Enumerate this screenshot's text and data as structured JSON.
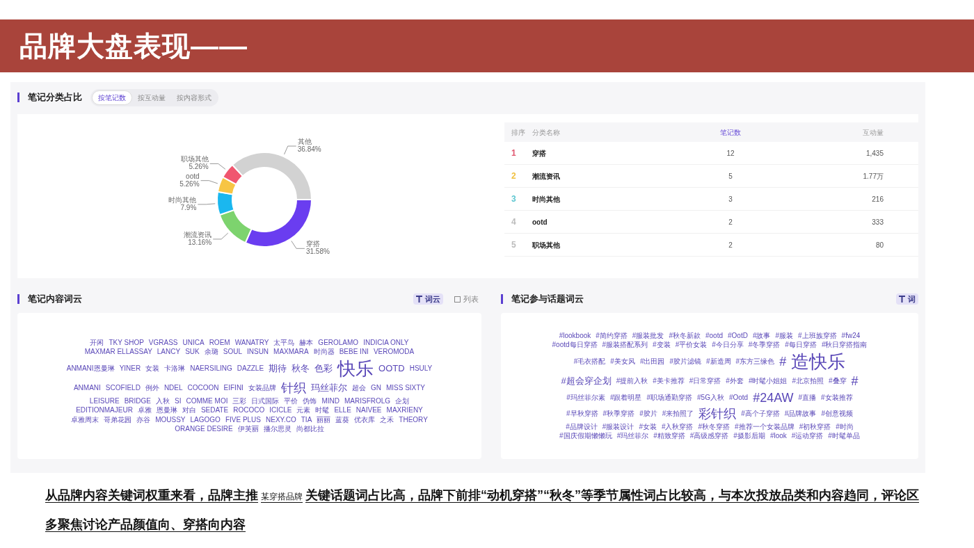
{
  "slide_title": "品牌大盘表现——",
  "category_section": {
    "title": "笔记分类占比",
    "tabs": [
      {
        "label": "按笔记数",
        "selected": true
      },
      {
        "label": "按互动量",
        "selected": false
      },
      {
        "label": "按内容形式",
        "selected": false
      }
    ],
    "chart_data": {
      "type": "donut",
      "categories": [
        "穿搭",
        "潮流资讯",
        "时尚其他",
        "ootd",
        "职场其他",
        "其他"
      ],
      "values": [
        31.58,
        13.16,
        7.9,
        5.26,
        5.26,
        36.84
      ],
      "colors": [
        "#6a3df0",
        "#7dd36e",
        "#1ab7ef",
        "#f7c544",
        "#f0566f",
        "#d2d2d2"
      ],
      "value_labels": [
        "31.58%",
        "13.16%",
        "7.9%",
        "5.26%",
        "5.26%",
        "36.84%"
      ]
    },
    "table": {
      "columns": [
        {
          "label": "排序",
          "selected": false
        },
        {
          "label": "分类名称",
          "selected": false
        },
        {
          "label": "笔记数",
          "selected": true
        },
        {
          "label": "互动量",
          "selected": false
        }
      ],
      "rows": [
        {
          "rank": "1",
          "color": "#e0566e",
          "name": "穿搭",
          "notes": "12",
          "interactions": "1,435"
        },
        {
          "rank": "2",
          "color": "#f0c040",
          "name": "潮流资讯",
          "notes": "5",
          "interactions": "1.77万"
        },
        {
          "rank": "3",
          "color": "#5cc6d0",
          "name": "时尚其他",
          "notes": "3",
          "interactions": "216"
        },
        {
          "rank": "4",
          "color": "#bbbbbb",
          "name": "ootd",
          "notes": "2",
          "interactions": "333"
        },
        {
          "rank": "5",
          "color": "#bbbbbb",
          "name": "职场其他",
          "notes": "2",
          "interactions": "80"
        }
      ]
    }
  },
  "content_cloud": {
    "title": "笔记内容词云",
    "toggles": [
      {
        "label": "词云",
        "kind": "cloud",
        "selected": true
      },
      {
        "label": "列表",
        "kind": "list",
        "selected": false
      }
    ],
    "words": [
      {
        "text": "开闲",
        "kind": "s"
      },
      {
        "text": "TKY SHOP",
        "kind": "s"
      },
      {
        "text": "VGRASS",
        "kind": "s"
      },
      {
        "text": "UNICA",
        "kind": "s"
      },
      {
        "text": "ROEM",
        "kind": "s"
      },
      {
        "text": "WANATRY",
        "kind": "s"
      },
      {
        "text": "太平鸟",
        "kind": "s"
      },
      {
        "text": "赫本",
        "kind": "s"
      },
      {
        "text": "GEROLAMO",
        "kind": "s"
      },
      {
        "text": "INDICIA ONLY",
        "kind": "s"
      },
      {
        "text": "MAXMAR ELLASSAY",
        "kind": "s"
      },
      {
        "text": "LANCY",
        "kind": "s"
      },
      {
        "text": "SUK",
        "kind": "s"
      },
      {
        "text": "余璐",
        "kind": "s"
      },
      {
        "text": "SOUL",
        "kind": "s"
      },
      {
        "text": "INSUN",
        "kind": "s"
      },
      {
        "text": "MAXMARA",
        "kind": "s"
      },
      {
        "text": "时尚器",
        "kind": "s"
      },
      {
        "text": "BEBE INI",
        "kind": "s"
      },
      {
        "text": "VEROMODA",
        "kind": "s"
      },
      {
        "text": "ANMANI恩曼琳",
        "kind": "s"
      },
      {
        "text": "YINER",
        "kind": "s"
      },
      {
        "text": "女装",
        "kind": "s"
      },
      {
        "text": "卡洛琳",
        "kind": "s"
      },
      {
        "text": "NAERSILING",
        "kind": "s"
      },
      {
        "text": "DAZZLE",
        "kind": "s"
      },
      {
        "text": "期待",
        "kind": "m"
      },
      {
        "text": "秋冬",
        "kind": "m"
      },
      {
        "text": "色彩",
        "kind": "m"
      },
      {
        "text": "快乐",
        "kind": "xl"
      },
      {
        "text": "OOTD",
        "kind": "m"
      },
      {
        "text": "HSULY",
        "kind": "s"
      },
      {
        "text": "ANMANI",
        "kind": "s"
      },
      {
        "text": "SCOFIELD",
        "kind": "s"
      },
      {
        "text": "例外",
        "kind": "s"
      },
      {
        "text": "NDEL",
        "kind": "s"
      },
      {
        "text": "COCOON",
        "kind": "s"
      },
      {
        "text": "EIFINI",
        "kind": "s"
      },
      {
        "text": "女装品牌",
        "kind": "s"
      },
      {
        "text": "针织",
        "kind": "l"
      },
      {
        "text": "玛丝菲尔",
        "kind": "m"
      },
      {
        "text": "超会",
        "kind": "s"
      },
      {
        "text": "GN",
        "kind": "s"
      },
      {
        "text": "MISS SIXTY",
        "kind": "s"
      },
      {
        "text": "LEISURE",
        "kind": "s"
      },
      {
        "text": "BRIDGE",
        "kind": "s"
      },
      {
        "text": "入秋",
        "kind": "s"
      },
      {
        "text": "SI",
        "kind": "s"
      },
      {
        "text": "COMME MOI",
        "kind": "s"
      },
      {
        "text": "三彩",
        "kind": "s"
      },
      {
        "text": "日式国际",
        "kind": "s"
      },
      {
        "text": "平价",
        "kind": "s"
      },
      {
        "text": "伪饰",
        "kind": "s"
      },
      {
        "text": "MIND",
        "kind": "s"
      },
      {
        "text": "MARISFROLG",
        "kind": "s"
      },
      {
        "text": "企划",
        "kind": "s"
      },
      {
        "text": "EDITIONMAJEUR",
        "kind": "s"
      },
      {
        "text": "卓雅",
        "kind": "s"
      },
      {
        "text": "恩曼琳",
        "kind": "s"
      },
      {
        "text": "对白",
        "kind": "s"
      },
      {
        "text": "SEDATE",
        "kind": "s"
      },
      {
        "text": "ROCOCO",
        "kind": "s"
      },
      {
        "text": "ICICLE",
        "kind": "s"
      },
      {
        "text": "元素",
        "kind": "s"
      },
      {
        "text": "时髦",
        "kind": "s"
      },
      {
        "text": "ELLE",
        "kind": "s"
      },
      {
        "text": "NAIVEE",
        "kind": "s"
      },
      {
        "text": "MAXRIENY",
        "kind": "s"
      },
      {
        "text": "卓雅周末",
        "kind": "s"
      },
      {
        "text": "哥弟花园",
        "kind": "s"
      },
      {
        "text": "亦谷",
        "kind": "s"
      },
      {
        "text": "MOUSSY",
        "kind": "s"
      },
      {
        "text": "LAGOGO",
        "kind": "s"
      },
      {
        "text": "FIVE PLUS",
        "kind": "s"
      },
      {
        "text": "NEXY.CO",
        "kind": "s"
      },
      {
        "text": "TIA",
        "kind": "s"
      },
      {
        "text": "丽丽",
        "kind": "s"
      },
      {
        "text": "蓝葵",
        "kind": "s"
      },
      {
        "text": "优衣库",
        "kind": "s"
      },
      {
        "text": "之禾",
        "kind": "s"
      },
      {
        "text": "THEORY",
        "kind": "s"
      },
      {
        "text": "ORANGE DESIRE",
        "kind": "s"
      },
      {
        "text": "伊芙丽",
        "kind": "s"
      },
      {
        "text": "播尔思灵",
        "kind": "s"
      },
      {
        "text": "尚都比拉",
        "kind": "s"
      }
    ]
  },
  "topic_cloud": {
    "title": "笔记参与话题词云",
    "toggles": [
      {
        "label": "词",
        "kind": "cloud",
        "selected": true
      }
    ],
    "words": [
      {
        "text": "#lookbook",
        "kind": "s"
      },
      {
        "text": "#简约穿搭",
        "kind": "s"
      },
      {
        "text": "#服装批发",
        "kind": "s"
      },
      {
        "text": "#秋冬新款",
        "kind": "s"
      },
      {
        "text": "#ootd",
        "kind": "s"
      },
      {
        "text": "#OotD",
        "kind": "s"
      },
      {
        "text": "#故事",
        "kind": "s"
      },
      {
        "text": "#服装",
        "kind": "s"
      },
      {
        "text": "#上班族穿搭",
        "kind": "s"
      },
      {
        "text": "#fw24",
        "kind": "s"
      },
      {
        "text": "#ootd每日穿搭",
        "kind": "s"
      },
      {
        "text": "#服装搭配系列",
        "kind": "s"
      },
      {
        "text": "#变装",
        "kind": "s"
      },
      {
        "text": "#平价女装",
        "kind": "s"
      },
      {
        "text": "#今日分享",
        "kind": "s"
      },
      {
        "text": "#冬季穿搭",
        "kind": "s"
      },
      {
        "text": "#每日穿搭",
        "kind": "s"
      },
      {
        "text": "#秋日穿搭指南",
        "kind": "s"
      },
      {
        "text": "#毛衣搭配",
        "kind": "s"
      },
      {
        "text": "#美女风",
        "kind": "s"
      },
      {
        "text": "#出田园",
        "kind": "s"
      },
      {
        "text": "#胶片滤镜",
        "kind": "s"
      },
      {
        "text": "#新造周",
        "kind": "s"
      },
      {
        "text": "#东方三缘色",
        "kind": "s"
      },
      {
        "text": "#",
        "kind": "l"
      },
      {
        "text": "造快乐",
        "kind": "xl"
      },
      {
        "text": "#超会穿企划",
        "kind": "m"
      },
      {
        "text": "#提前入秋",
        "kind": "s"
      },
      {
        "text": "#美卡推荐",
        "kind": "s"
      },
      {
        "text": "#日常穿搭",
        "kind": "s"
      },
      {
        "text": "#外套",
        "kind": "s"
      },
      {
        "text": "#时髦小姐姐",
        "kind": "s"
      },
      {
        "text": "#北京拍照",
        "kind": "s"
      },
      {
        "text": "#叠穿",
        "kind": "s"
      },
      {
        "text": "#",
        "kind": "l"
      },
      {
        "text": "#玛丝菲尔素",
        "kind": "s"
      },
      {
        "text": "#跟着明星",
        "kind": "s"
      },
      {
        "text": "#职场通勤穿搭",
        "kind": "s"
      },
      {
        "text": "#5G入秋",
        "kind": "s"
      },
      {
        "text": "#Ootd",
        "kind": "s"
      },
      {
        "text": "#24AW",
        "kind": "l"
      },
      {
        "text": "#直播",
        "kind": "s"
      },
      {
        "text": "#女装推荐",
        "kind": "s"
      },
      {
        "text": "#早秋穿搭",
        "kind": "s"
      },
      {
        "text": "#秋季穿搭",
        "kind": "s"
      },
      {
        "text": "#胶片",
        "kind": "s"
      },
      {
        "text": "#来拍照了",
        "kind": "s"
      },
      {
        "text": "彩针织",
        "kind": "l"
      },
      {
        "text": "#高个子穿搭",
        "kind": "s"
      },
      {
        "text": "#品牌故事",
        "kind": "s"
      },
      {
        "text": "#创意视频",
        "kind": "s"
      },
      {
        "text": "#品牌设计",
        "kind": "s"
      },
      {
        "text": "#服装设计",
        "kind": "s"
      },
      {
        "text": "#女装",
        "kind": "s"
      },
      {
        "text": "#入秋穿搭",
        "kind": "s"
      },
      {
        "text": "#秋冬穿搭",
        "kind": "s"
      },
      {
        "text": "#推荐一个女装品牌",
        "kind": "s"
      },
      {
        "text": "#初秋穿搭",
        "kind": "s"
      },
      {
        "text": "#时尚",
        "kind": "s"
      },
      {
        "text": "#国庆假期懒懒玩",
        "kind": "s"
      },
      {
        "text": "#玛丝菲尔",
        "kind": "s"
      },
      {
        "text": "#精致穿搭",
        "kind": "s"
      },
      {
        "text": "#高级感穿搭",
        "kind": "s"
      },
      {
        "text": "#摄影后期",
        "kind": "s"
      },
      {
        "text": "#look",
        "kind": "s"
      },
      {
        "text": "#运动穿搭",
        "kind": "s"
      },
      {
        "text": "#时髦单品",
        "kind": "s"
      }
    ]
  },
  "summary": {
    "parts": [
      {
        "text": "从品牌内容关键词权重来看，品牌主推",
        "kind": "normal"
      },
      {
        "text": "某穿搭品牌",
        "kind": "small"
      },
      {
        "text": "关键话题词占比高，品牌下前排“动机穿搭”“秋冬”等季节属性词占比较高，与本次投放品类和内容趋同，评论区多聚焦讨论产品颜值向、穿搭向内容",
        "kind": "normal"
      }
    ]
  }
}
